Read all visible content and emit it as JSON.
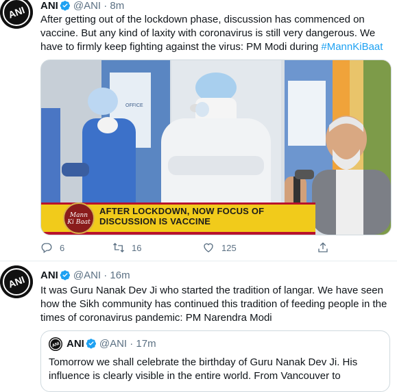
{
  "colors": {
    "link": "#1da1f2",
    "secondary": "#5b7083",
    "verified": "#1da1f2"
  },
  "tweets": [
    {
      "name": "ANI",
      "handle": "@ANI",
      "time": "8m",
      "text": "After getting out of the lockdown phase, discussion has commenced on vaccine. But any kind of laxity with coronavirus is still very dangerous. We have to firmly keep fighting against the virus: PM Modi during ",
      "hashtag": "#MannKiBaat",
      "media": {
        "logo_text_1": "Mann",
        "logo_text_2": "Ki",
        "logo_text_3": "Baat",
        "banner_line_1": "AFTER LOCKDOWN, NOW FOCUS OF",
        "banner_line_2": "DISCUSSION IS VACCINE",
        "sign_text": "OFFICE"
      },
      "actions": {
        "replies": "6",
        "retweets": "16",
        "likes": "125"
      }
    },
    {
      "name": "ANI",
      "handle": "@ANI",
      "time": "16m",
      "text": "It was Guru Nanak Dev Ji who started the tradition of langar. We have seen how the Sikh community has continued this tradition of feeding people in the times of coronavirus pandemic: PM Narendra Modi",
      "quote": {
        "name": "ANI",
        "handle": "@ANI",
        "time": "17m",
        "text": "Tomorrow we shall celebrate the birthday of Guru Nanak Dev Ji. His influence is clearly visible in the entire world. From Vancouver to"
      }
    }
  ],
  "separator": "·",
  "icons": {
    "verified": "verified-badge-icon",
    "reply": "reply-icon",
    "retweet": "retweet-icon",
    "like": "heart-icon",
    "share": "share-icon",
    "avatar": "ani-logo-avatar"
  }
}
